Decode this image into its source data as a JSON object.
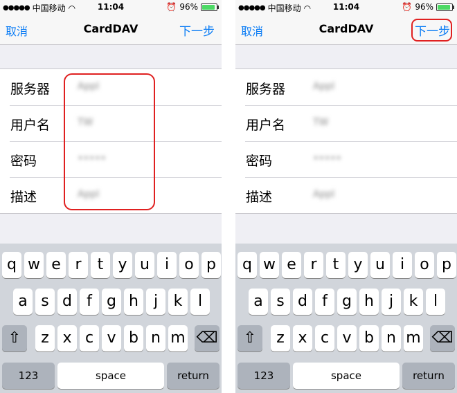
{
  "status": {
    "carrier": "中国移动",
    "time": "11:04",
    "battery": "96%"
  },
  "nav": {
    "cancel": "取消",
    "title": "CardDAV",
    "next": "下一步"
  },
  "form": [
    {
      "label": "服务器",
      "value": "Appl"
    },
    {
      "label": "用户名",
      "value": "TW"
    },
    {
      "label": "密码",
      "value": "•••••"
    },
    {
      "label": "描述",
      "value": "Appl"
    }
  ],
  "keyboard": {
    "row1": [
      "q",
      "w",
      "e",
      "r",
      "t",
      "y",
      "u",
      "i",
      "o",
      "p"
    ],
    "row2": [
      "a",
      "s",
      "d",
      "f",
      "g",
      "h",
      "j",
      "k",
      "l"
    ],
    "row3": [
      "z",
      "x",
      "c",
      "v",
      "b",
      "n",
      "m"
    ],
    "numbers": "123",
    "space": "space",
    "return": "return",
    "shift_icon": "shift-icon",
    "delete_icon": "delete-icon"
  },
  "colors": {
    "accent": "#0a7cf5",
    "highlight": "#e02020",
    "battery": "#4cd964"
  }
}
